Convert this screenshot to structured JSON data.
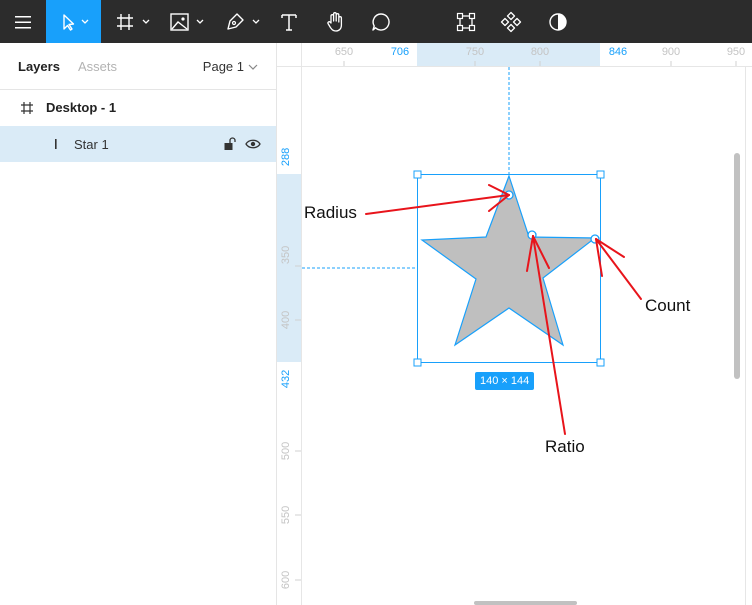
{
  "toolbar": {
    "tools": [
      {
        "name": "menu-icon"
      },
      {
        "name": "move-tool-icon",
        "active": true
      },
      {
        "name": "frame-tool-icon"
      },
      {
        "name": "image-tool-icon"
      },
      {
        "name": "pen-tool-icon"
      },
      {
        "name": "text-tool-icon"
      },
      {
        "name": "hand-tool-icon"
      },
      {
        "name": "comment-tool-icon"
      },
      {
        "name": "component-edit-icon"
      },
      {
        "name": "components-icon"
      },
      {
        "name": "contrast-icon"
      }
    ],
    "accent": "#18a0fb",
    "background": "#2c2c2c"
  },
  "left_panel": {
    "tabs": {
      "layers": "Layers",
      "assets": "Assets"
    },
    "page_selector": "Page 1",
    "layers": [
      {
        "label": "Desktop - 1",
        "type": "frame"
      },
      {
        "label": "Star 1",
        "type": "star",
        "selected": true
      }
    ]
  },
  "rulers": {
    "top": {
      "ticks": [
        "650",
        "706",
        "750",
        "800",
        "846",
        "900",
        "950"
      ],
      "highlight": [
        "706",
        "846"
      ]
    },
    "left": {
      "ticks": [
        "288",
        "350",
        "400",
        "432",
        "500",
        "550",
        "600"
      ],
      "highlight": [
        "288",
        "432"
      ]
    }
  },
  "canvas": {
    "dimension_badge": "140 × 144",
    "annotations": {
      "radius": "Radius",
      "count": "Count",
      "ratio": "Ratio"
    },
    "star_fill": "#bfbfbf",
    "selection_color": "#18a0fb",
    "arrow_color": "#e8141b"
  }
}
